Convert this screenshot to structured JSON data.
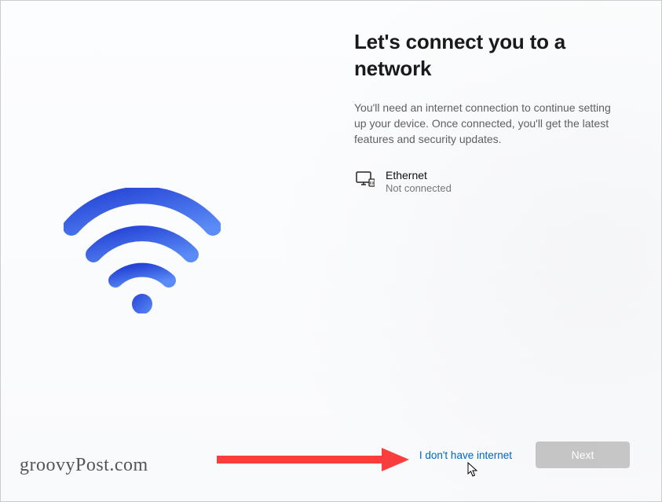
{
  "header": {
    "title": "Let's connect you to a network",
    "description": "You'll need an internet connection to continue setting up your device. Once connected, you'll get the latest features and security updates."
  },
  "network": {
    "name": "Ethernet",
    "status": "Not connected"
  },
  "footer": {
    "skip_label": "I don't have internet",
    "next_label": "Next"
  },
  "watermark": "groovyPost.com",
  "colors": {
    "accent": "#0067c0",
    "wifi_grad_a": "#2645d6",
    "wifi_grad_b": "#5a8bf6",
    "arrow": "#fa3e3e",
    "next_bg": "#c3c3c3"
  }
}
